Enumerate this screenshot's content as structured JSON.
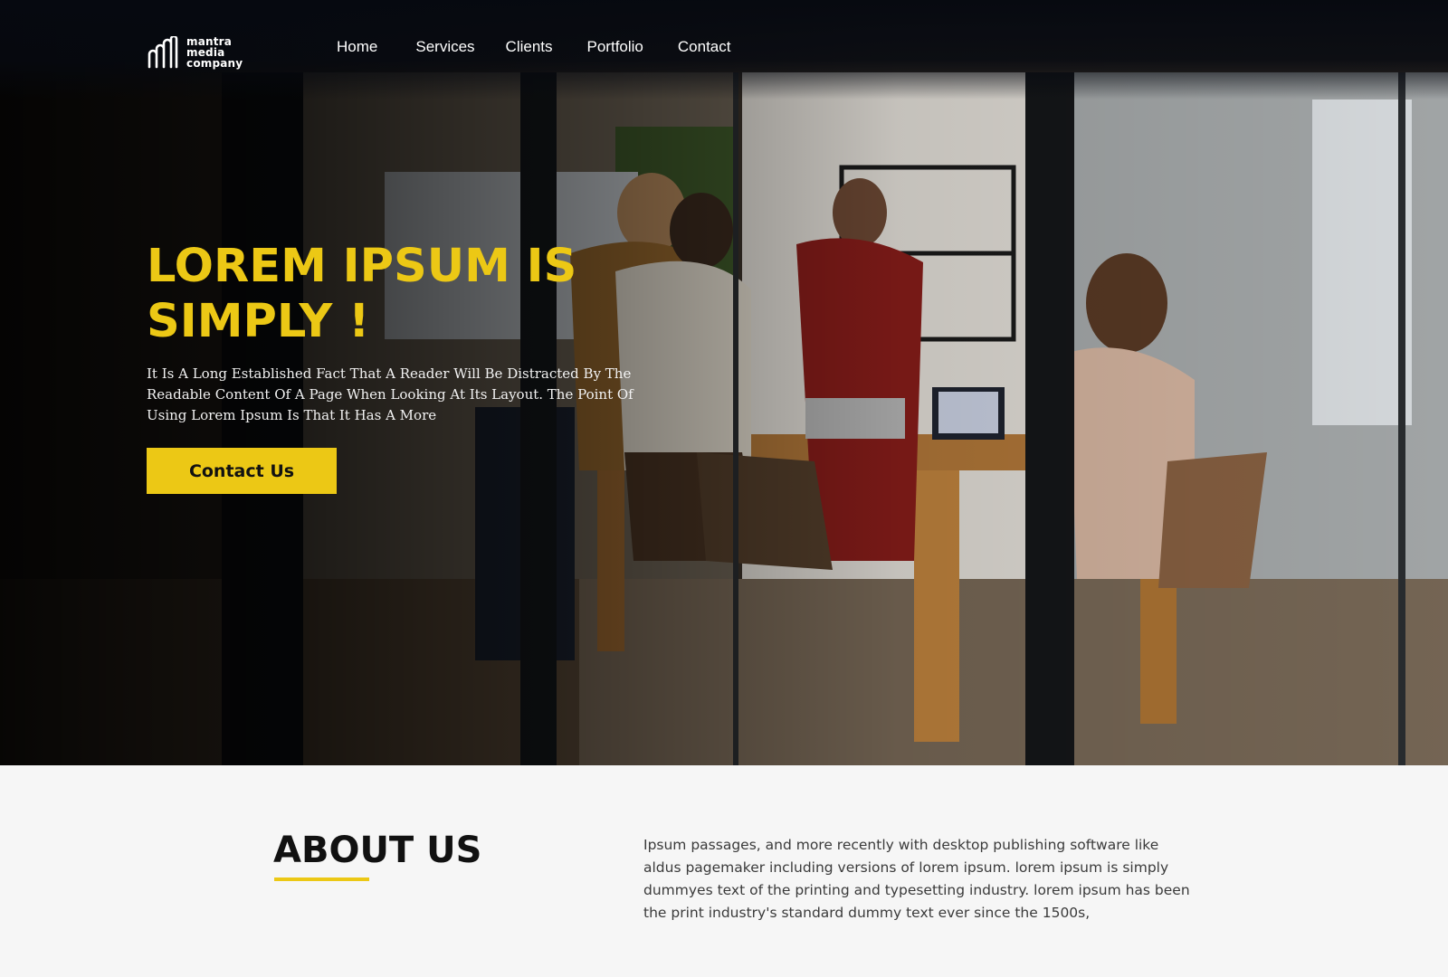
{
  "brand": {
    "logo_lines": [
      "mantra",
      "media",
      "company"
    ]
  },
  "nav": {
    "items": [
      {
        "label": "Home"
      },
      {
        "label": "Services"
      },
      {
        "label": "Clients"
      },
      {
        "label": "Portfolio"
      },
      {
        "label": "Contact"
      }
    ]
  },
  "hero": {
    "title_line1": "LOREM IPSUM IS",
    "title_line2": "SIMPLY !",
    "description": "It Is A Long Established Fact That A Reader Will Be Distracted By The Readable Content Of A Page When Looking At Its Layout. The Point Of Using Lorem Ipsum Is That It Has A More",
    "cta_label": "Contact Us",
    "background_icon": "office-meeting-photo"
  },
  "about": {
    "title": "ABOUT US",
    "body": "Ipsum passages, and more recently with desktop publishing software like aldus pagemaker including versions of lorem ipsum. lorem ipsum is simply dummyes text of the printing and typesetting industry. lorem ipsum has been the print industry's standard dummy text ever since the 1500s,"
  },
  "colors": {
    "accent": "#ecc815",
    "nav_bg": "#060910",
    "about_bg": "#f6f6f6",
    "heading_dark": "#111111"
  }
}
